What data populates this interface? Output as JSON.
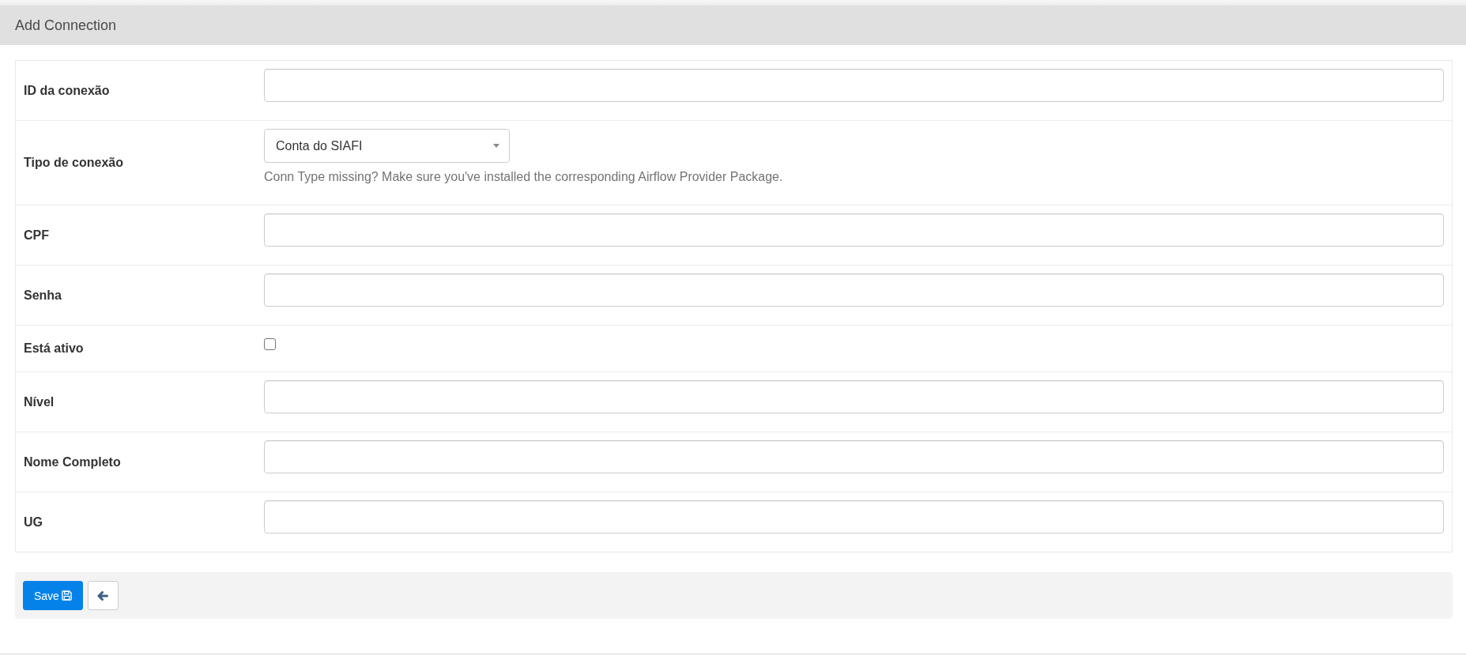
{
  "title": "Add Connection",
  "fields": [
    {
      "label": "ID da conexão",
      "kind": "text"
    },
    {
      "label": "Tipo de conexão",
      "kind": "select",
      "value": "Conta do SIAFI",
      "help": "Conn Type missing? Make sure you've installed the corresponding Airflow Provider Package."
    },
    {
      "label": "CPF",
      "kind": "text"
    },
    {
      "label": "Senha",
      "kind": "text"
    },
    {
      "label": "Está ativo",
      "kind": "checkbox",
      "checked": false
    },
    {
      "label": "Nível",
      "kind": "text"
    },
    {
      "label": "Nome Completo",
      "kind": "text"
    },
    {
      "label": "UG",
      "kind": "text"
    }
  ],
  "actions": [
    {
      "kind": "save",
      "label": "Save"
    },
    {
      "kind": "back"
    }
  ]
}
